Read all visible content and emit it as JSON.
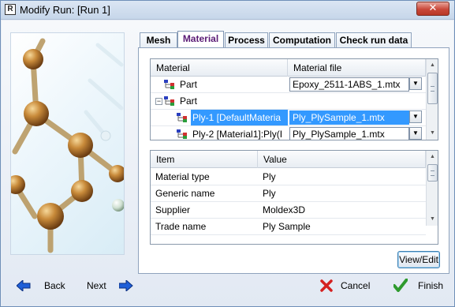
{
  "window": {
    "title": "Modify Run: [Run 1]",
    "app_icon": "R",
    "close_glyph": "✕"
  },
  "tabs": [
    "Mesh",
    "Material",
    "Process",
    "Computation",
    "Check run data"
  ],
  "active_tab": "Material",
  "material_grid": {
    "headers": [
      "Material",
      "Material file"
    ],
    "rows": [
      {
        "label": "Part",
        "file": "Epoxy_2511-1ABS_1.mtx",
        "toggle": "",
        "selected": false
      },
      {
        "label": "Part",
        "file": "",
        "toggle": "−",
        "selected": false
      },
      {
        "label": "Ply-1 [DefaultMateria",
        "file": "Ply_PlySample_1.mtx",
        "toggle": "",
        "selected": true
      },
      {
        "label": "Ply-2 [Material1]:Ply(I",
        "file": "Ply_PlySample_1.mtx",
        "toggle": "",
        "selected": false
      }
    ]
  },
  "property_grid": {
    "headers": [
      "Item",
      "Value"
    ],
    "rows": [
      {
        "item": "Material type",
        "value": "Ply"
      },
      {
        "item": "Generic name",
        "value": "Ply"
      },
      {
        "item": "Supplier",
        "value": "Moldex3D"
      },
      {
        "item": "Trade name",
        "value": "Ply Sample"
      }
    ]
  },
  "view_edit_label": "View/Edit",
  "footer": {
    "back": "Back",
    "next": "Next",
    "cancel": "Cancel",
    "finish": "Finish"
  },
  "colors": {
    "selection": "#3399ff",
    "active_tab_text": "#5a1a75",
    "close_button": "#c9483a"
  }
}
